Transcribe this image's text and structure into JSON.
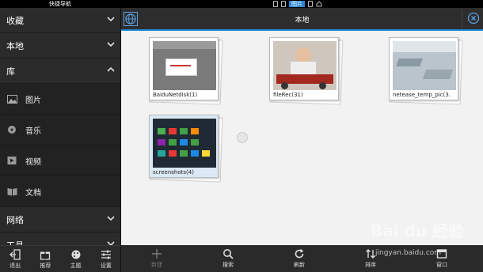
{
  "statusbar": {
    "left_label": "快捷导航",
    "active_tab": "图片"
  },
  "sidebar": {
    "sections": [
      {
        "label": "收藏",
        "expanded": false
      },
      {
        "label": "本地",
        "expanded": false
      },
      {
        "label": "库",
        "expanded": true
      },
      {
        "label": "网络",
        "expanded": false
      },
      {
        "label": "工具",
        "expanded": false
      }
    ],
    "items": [
      {
        "label": "图片",
        "icon": "image-icon"
      },
      {
        "label": "音乐",
        "icon": "music-icon"
      },
      {
        "label": "视频",
        "icon": "video-icon"
      },
      {
        "label": "文档",
        "icon": "document-icon"
      }
    ],
    "bottom_buttons": [
      {
        "label": "退出",
        "icon": "exit-icon"
      },
      {
        "label": "推荐",
        "icon": "gift-icon"
      },
      {
        "label": "主题",
        "icon": "palette-icon"
      },
      {
        "label": "设置",
        "icon": "settings-icon"
      }
    ]
  },
  "main": {
    "title": "本地",
    "folders": [
      {
        "label": "BaiduNetdisk(1)"
      },
      {
        "label": "fileRec(31)"
      },
      {
        "label": "netease_temp_pic(3."
      },
      {
        "label": "screenshots(4)"
      }
    ],
    "bottom_buttons": [
      {
        "label": "新建",
        "icon": "plus-icon",
        "enabled": false
      },
      {
        "label": "搜索",
        "icon": "search-icon",
        "enabled": true
      },
      {
        "label": "刷新",
        "icon": "refresh-icon",
        "enabled": true
      },
      {
        "label": "排序",
        "icon": "sort-icon",
        "enabled": true
      },
      {
        "label": "窗口",
        "icon": "window-icon",
        "enabled": true
      }
    ]
  },
  "watermark": {
    "brand": "Bai du 经验",
    "url": "jingyan.baidu.com"
  },
  "colors": {
    "accent": "#1e88d6",
    "sidebar_bg": "#262626",
    "content_bg": "#f2f2f2"
  }
}
